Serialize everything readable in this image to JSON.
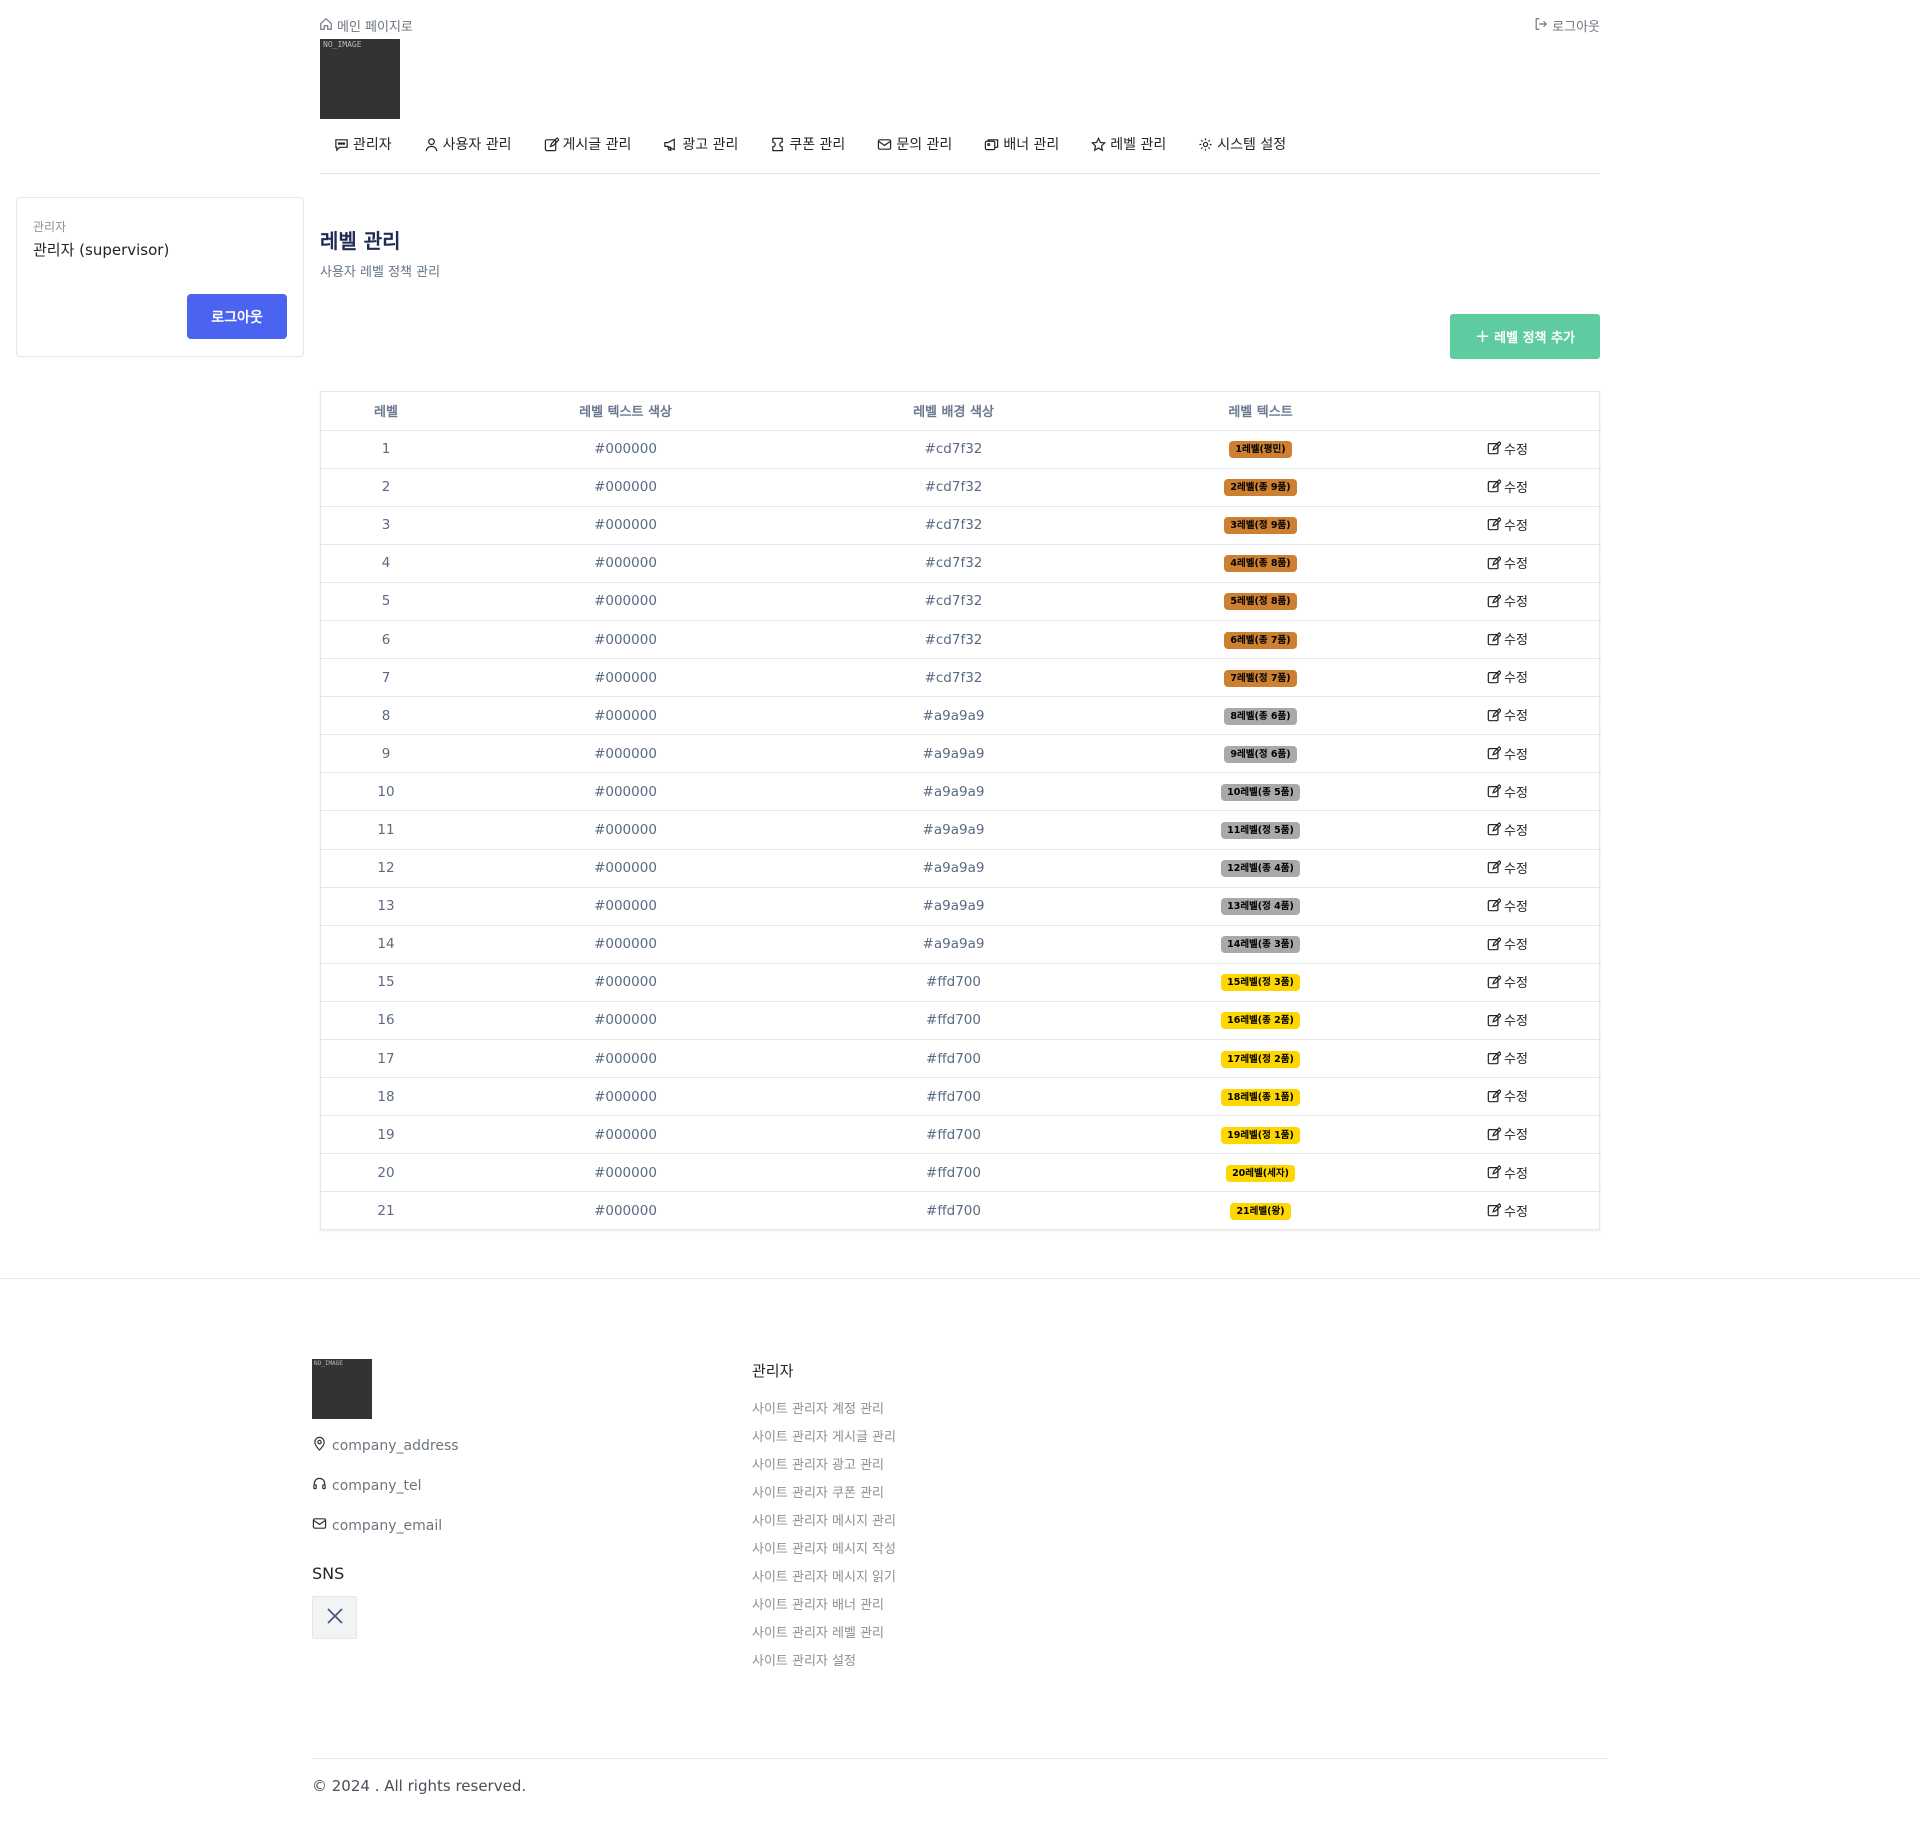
{
  "header": {
    "back_link": "메인 페이지로",
    "logout_link": "로그아웃",
    "logo_placeholder": "NO_IMAGE"
  },
  "nav": {
    "items": [
      {
        "label": "관리자",
        "icon": "chat-icon"
      },
      {
        "label": "사용자 관리",
        "icon": "user-icon"
      },
      {
        "label": "게시글 관리",
        "icon": "edit-icon"
      },
      {
        "label": "광고 관리",
        "icon": "megaphone-icon"
      },
      {
        "label": "쿠폰 관리",
        "icon": "coupon-icon"
      },
      {
        "label": "문의 관리",
        "icon": "mail-icon"
      },
      {
        "label": "배너 관리",
        "icon": "images-icon"
      },
      {
        "label": "레벨 관리",
        "icon": "star-icon"
      },
      {
        "label": "시스템 설정",
        "icon": "gear-icon"
      }
    ]
  },
  "admin_card": {
    "role": "관리자",
    "name": "관리자 (supervisor)",
    "logout_button": "로그아웃",
    "button_color": "#4a63f0"
  },
  "page": {
    "title": "레벨 관리",
    "subtitle": "사용자 레벨 정책 관리",
    "add_button": "레벨 정책 추가",
    "add_button_color": "#5ecba1"
  },
  "table": {
    "columns": [
      "레벨",
      "레벨 텍스트 색상",
      "레벨 배경 색상",
      "레벨 텍스트",
      ""
    ],
    "edit_label": "수정",
    "rows": [
      {
        "level": "1",
        "text_color": "#000000",
        "bg_color": "#cd7f32",
        "label": "1레벨(평민)"
      },
      {
        "level": "2",
        "text_color": "#000000",
        "bg_color": "#cd7f32",
        "label": "2레벨(종 9품)"
      },
      {
        "level": "3",
        "text_color": "#000000",
        "bg_color": "#cd7f32",
        "label": "3레벨(정 9품)"
      },
      {
        "level": "4",
        "text_color": "#000000",
        "bg_color": "#cd7f32",
        "label": "4레벨(종 8품)"
      },
      {
        "level": "5",
        "text_color": "#000000",
        "bg_color": "#cd7f32",
        "label": "5레벨(정 8품)"
      },
      {
        "level": "6",
        "text_color": "#000000",
        "bg_color": "#cd7f32",
        "label": "6레벨(종 7품)"
      },
      {
        "level": "7",
        "text_color": "#000000",
        "bg_color": "#cd7f32",
        "label": "7레벨(정 7품)"
      },
      {
        "level": "8",
        "text_color": "#000000",
        "bg_color": "#a9a9a9",
        "label": "8레벨(종 6품)"
      },
      {
        "level": "9",
        "text_color": "#000000",
        "bg_color": "#a9a9a9",
        "label": "9레벨(정 6품)"
      },
      {
        "level": "10",
        "text_color": "#000000",
        "bg_color": "#a9a9a9",
        "label": "10레벨(종 5품)"
      },
      {
        "level": "11",
        "text_color": "#000000",
        "bg_color": "#a9a9a9",
        "label": "11레벨(정 5품)"
      },
      {
        "level": "12",
        "text_color": "#000000",
        "bg_color": "#a9a9a9",
        "label": "12레벨(종 4품)"
      },
      {
        "level": "13",
        "text_color": "#000000",
        "bg_color": "#a9a9a9",
        "label": "13레벨(정 4품)"
      },
      {
        "level": "14",
        "text_color": "#000000",
        "bg_color": "#a9a9a9",
        "label": "14레벨(종 3품)"
      },
      {
        "level": "15",
        "text_color": "#000000",
        "bg_color": "#ffd700",
        "label": "15레벨(정 3품)"
      },
      {
        "level": "16",
        "text_color": "#000000",
        "bg_color": "#ffd700",
        "label": "16레벨(종 2품)"
      },
      {
        "level": "17",
        "text_color": "#000000",
        "bg_color": "#ffd700",
        "label": "17레벨(정 2품)"
      },
      {
        "level": "18",
        "text_color": "#000000",
        "bg_color": "#ffd700",
        "label": "18레벨(종 1품)"
      },
      {
        "level": "19",
        "text_color": "#000000",
        "bg_color": "#ffd700",
        "label": "19레벨(정 1품)"
      },
      {
        "level": "20",
        "text_color": "#000000",
        "bg_color": "#ffd700",
        "label": "20레벨(세자)"
      },
      {
        "level": "21",
        "text_color": "#000000",
        "bg_color": "#ffd700",
        "label": "21레벨(왕)"
      }
    ]
  },
  "footer": {
    "logo_placeholder": "NO_IMAGE",
    "address": "company_address",
    "tel": "company_tel",
    "email": "company_email",
    "sns_title": "SNS",
    "menu_title": "관리자",
    "links": [
      "사이트 관리자 계정 관리",
      "사이트 관리자 게시글 관리",
      "사이트 관리자 광고 관리",
      "사이트 관리자 쿠폰 관리",
      "사이트 관리자 메시지 관리",
      "사이트 관리자 메시지 작성",
      "사이트 관리자 메시지 읽기",
      "사이트 관리자 배너 관리",
      "사이트 관리자 레벨 관리",
      "사이트 관리자 설정"
    ],
    "copyright": "© 2024 . All rights reserved."
  }
}
